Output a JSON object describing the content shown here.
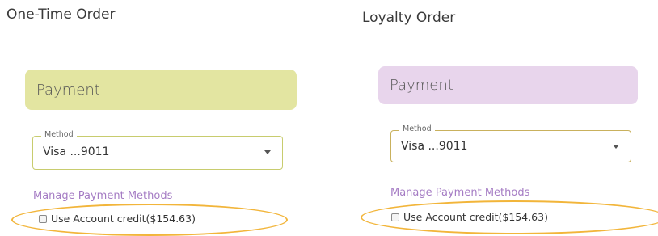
{
  "colors": {
    "one_time_header_bg": "#e3e5a1",
    "loyalty_header_bg": "#e8d5ec",
    "one_time_field_border": "#c8cc6e",
    "loyalty_field_border": "#c9b15d",
    "link": "#a57cc4",
    "highlight": "#f2b53a"
  },
  "one_time": {
    "title": "One-Time Order",
    "payment_header": "Payment",
    "method": {
      "legend": "Method",
      "value": "Visa ...9011",
      "icon": "chevron-down-icon"
    },
    "manage_link": "Manage Payment Methods",
    "account_credit": {
      "label": "Use Account credit($154.63)",
      "checked": false
    }
  },
  "loyalty": {
    "title": "Loyalty Order",
    "payment_header": "Payment",
    "method": {
      "legend": "Method",
      "value": "Visa ...9011",
      "icon": "chevron-down-icon"
    },
    "manage_link": "Manage Payment Methods",
    "account_credit": {
      "label": "Use Account credit($154.63)",
      "checked": false
    }
  }
}
